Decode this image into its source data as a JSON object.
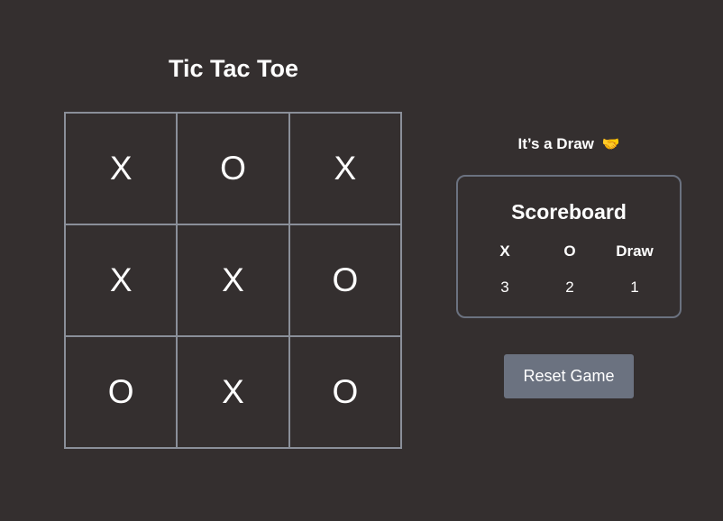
{
  "title": "Tic Tac Toe",
  "board": {
    "cells": [
      "X",
      "O",
      "X",
      "X",
      "X",
      "O",
      "O",
      "X",
      "O"
    ]
  },
  "status": {
    "text": "It’s a Draw",
    "emoji": "🤝"
  },
  "scoreboard": {
    "title": "Scoreboard",
    "headers": [
      "X",
      "O",
      "Draw"
    ],
    "values": [
      "3",
      "2",
      "1"
    ]
  },
  "reset_label": "Reset Game",
  "colors": {
    "background": "#342f2f",
    "grid_line": "#8a8f99",
    "button": "#6b7280",
    "text": "#ffffff"
  }
}
